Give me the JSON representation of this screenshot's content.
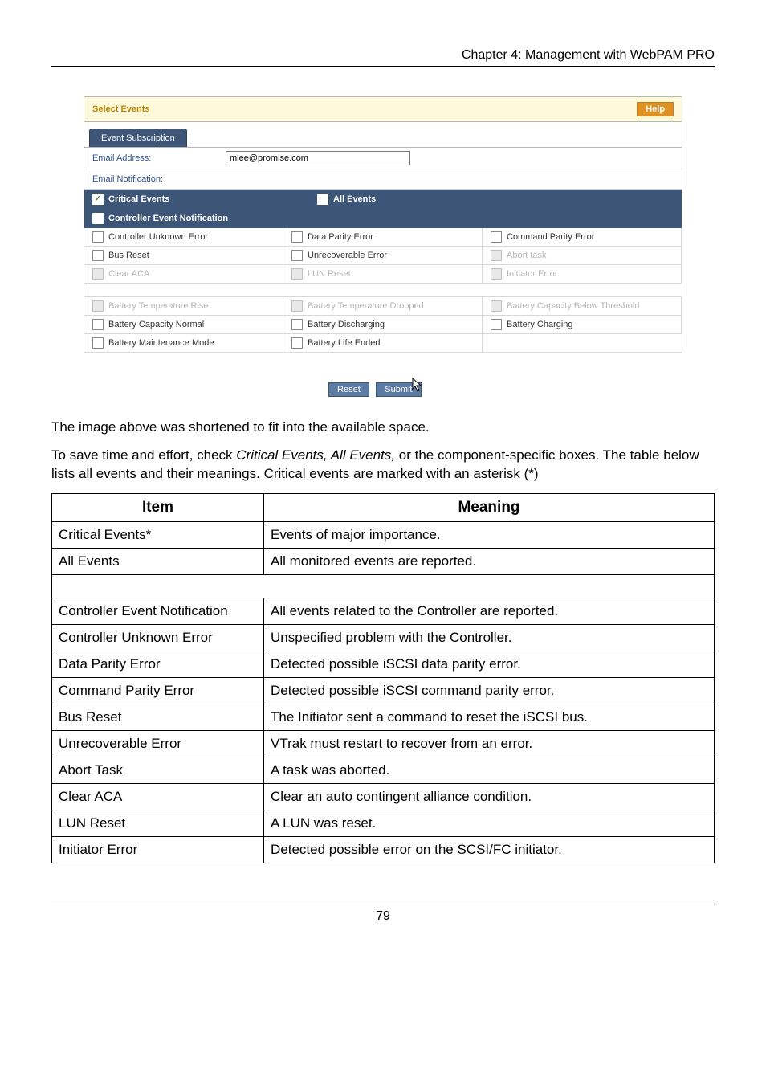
{
  "chapter_header": "Chapter 4: Management with WebPAM PRO",
  "panel": {
    "title": "Select Events",
    "help": "Help",
    "tab": "Event Subscription",
    "email_label": "Email Address:",
    "email_value": "mlee@promise.com",
    "notif_label": "Email Notification:",
    "critical_label": "Critical Events",
    "all_label": "All Events",
    "group1": "Controller Event Notification",
    "rows1": [
      [
        "Controller Unknown Error",
        "Data Parity Error",
        "Command Parity Error"
      ],
      [
        "Bus Reset",
        "Unrecoverable Error",
        "Abort task"
      ],
      [
        "Clear ACA",
        "LUN Reset",
        "Initiator Error"
      ]
    ],
    "rows2": [
      [
        "Battery Temperature Rise",
        "Battery Temperature Dropped",
        "Battery Capacity Below Threshold"
      ],
      [
        "Battery Capacity Normal",
        "Battery Discharging",
        "Battery Charging"
      ],
      [
        "Battery Maintenance Mode",
        "Battery Life Ended",
        ""
      ]
    ],
    "reset": "Reset",
    "submit": "Submit"
  },
  "para1": "The image above was shortened to fit into the available space.",
  "para2_a": "To save time and effort, check ",
  "para2_b": "Critical Events, All Events,",
  "para2_c": " or the component-specific boxes. The table below lists all events and their meanings. Critical events are marked with an asterisk (*)",
  "table": {
    "h_item": "Item",
    "h_meaning": "Meaning",
    "rows": [
      {
        "item": "Critical Events*",
        "meaning": "Events of major importance."
      },
      {
        "item": "All Events",
        "meaning": "All monitored events are reported."
      }
    ],
    "rows2": [
      {
        "item": "Controller Event Notification",
        "meaning": "All events related to the Controller are reported."
      },
      {
        "item": "Controller Unknown Error",
        "meaning": "Unspecified problem with the Controller."
      },
      {
        "item": "Data Parity Error",
        "meaning": "Detected possible iSCSI data parity error."
      },
      {
        "item": "Command Parity Error",
        "meaning": "Detected possible iSCSI command parity error."
      },
      {
        "item": "Bus Reset",
        "meaning": "The Initiator sent a command to reset the iSCSI bus."
      },
      {
        "item": "Unrecoverable Error",
        "meaning": "VTrak must restart to recover from an error."
      },
      {
        "item": "Abort Task",
        "meaning": "A task was aborted."
      },
      {
        "item": "Clear ACA",
        "meaning": "Clear an auto contingent alliance condition."
      },
      {
        "item": "LUN Reset",
        "meaning": "A LUN was reset."
      },
      {
        "item": "Initiator Error",
        "meaning": "Detected possible error on the SCSI/FC initiator."
      }
    ]
  },
  "page_num": "79"
}
